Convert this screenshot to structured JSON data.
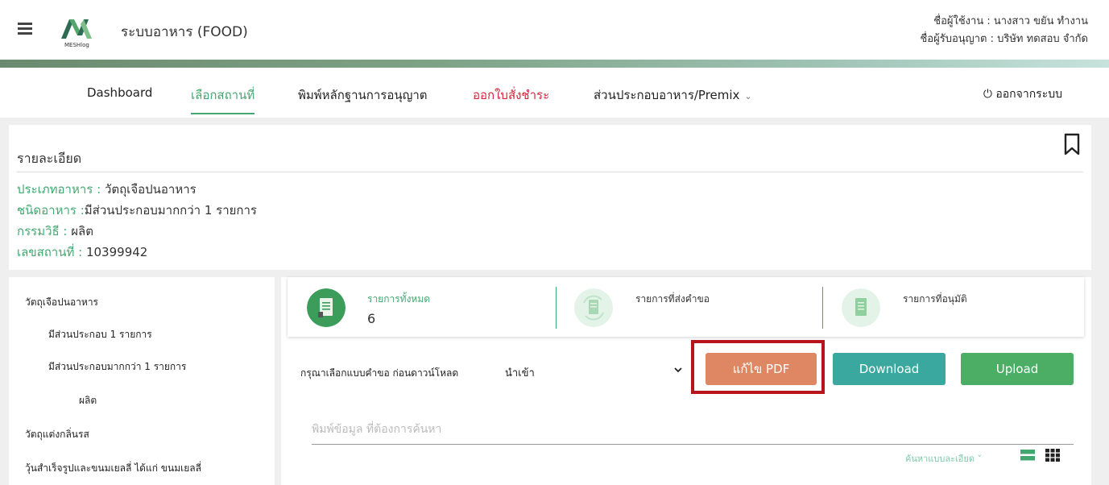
{
  "header": {
    "app_title": "ระบบอาหาร (FOOD)",
    "logo_text": "MESHlog",
    "user_line": "ชื่อผู้ใช้งาน : นางสาว ขยัน ทำงาน",
    "licensee_line": "ชื่อผู้รับอนุญาต : บริษัท ทดสอบ จำกัด"
  },
  "nav": {
    "items": [
      {
        "label": "Dashboard"
      },
      {
        "label": "เลือกสถานที่"
      },
      {
        "label": "พิมพ์หลักฐานการอนุญาต"
      },
      {
        "label": "ออกใบสั่งชำระ"
      },
      {
        "label": "ส่วนประกอบอาหาร/Premix"
      }
    ],
    "logout_label": "ออกจากระบบ",
    "active_color": "#43a870",
    "alert_color": "#d6243a"
  },
  "detail": {
    "title": "รายละเอียด",
    "lines": [
      {
        "label": "ประเภทอาหาร :",
        "value": " วัตถุเจือปนอาหาร"
      },
      {
        "label": "ชนิดอาหาร :",
        "value": "มีส่วนประกอบมากกว่า 1 รายการ"
      },
      {
        "label": "กรรมวิธี :",
        "value": " ผลิต"
      },
      {
        "label": "เลขสถานที่ :",
        "value": " 10399942"
      }
    ]
  },
  "sidebar": {
    "items": [
      {
        "label": "วัตถุเจือปนอาหาร"
      },
      {
        "label": "มีส่วนประกอบ 1 รายการ"
      },
      {
        "label": "มีส่วนประกอบมากกว่า 1 รายการ"
      },
      {
        "label": "ผลิต"
      },
      {
        "label": "วัตถุแต่งกลิ่นรส"
      },
      {
        "label": "วุ้นสำเร็จรูปและขนมเยลลี่ ได้แก่ ขนมเยลลี่"
      }
    ]
  },
  "stats": [
    {
      "label": "รายการทั้งหมด",
      "value": "6"
    },
    {
      "label": "รายการที่ส่งคำขอ",
      "value": ""
    },
    {
      "label": "รายการที่อนุมัติ",
      "value": ""
    }
  ],
  "download": {
    "prompt": "กรุณาเลือกแบบคำขอ ก่อนดาวน์โหลด",
    "selected": "นำเข้า",
    "edit_pdf_label": "แก้ไข PDF",
    "download_label": "Download",
    "upload_label": "Upload"
  },
  "search": {
    "placeholder": "พิมพ์ข้อมูล ที่ต้องการค้นหา",
    "advanced_label": "ค้นหาแบบละเอียด ˅"
  },
  "colors": {
    "pdf_button": "#df8663",
    "download_button": "#3aa89e",
    "upload_button": "#4cae64",
    "highlight_border": "#b8141b"
  }
}
